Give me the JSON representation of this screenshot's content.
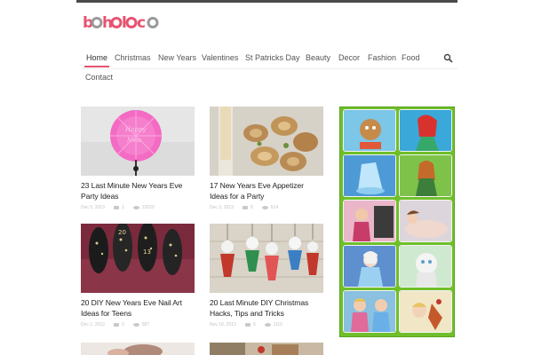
{
  "site": {
    "logo_text": "boholoco",
    "colors": {
      "accent": "#e8526f",
      "ring": "#9a9a9a",
      "ad_bg": "#6fbf2a"
    }
  },
  "nav": {
    "items": [
      "Home",
      "Christmas",
      "New Years",
      "Valentines",
      "St Patricks Day",
      "Beauty",
      "Decor",
      "Fashion",
      "Food",
      "Contact"
    ],
    "active": "Home",
    "search_icon": "search-icon"
  },
  "posts": [
    {
      "title": "23 Last Minute New Years Eve Party Ideas",
      "date": "Dec 5, 2013",
      "comments": "1",
      "views": "10020"
    },
    {
      "title": "17 New Years Eve Appetizer Ideas for a Party",
      "date": "Dec 3, 2013",
      "comments": "0",
      "views": "614"
    },
    {
      "title": "20 DIY New Years Eve Nail Art Ideas for Teens",
      "date": "Dec 1, 2013",
      "comments": "0",
      "views": "587"
    },
    {
      "title": "20 Last Minute DIY Christmas Hacks, Tips and Tricks",
      "date": "Nov 18, 2013",
      "comments": "0",
      "views": "1110"
    }
  ]
}
